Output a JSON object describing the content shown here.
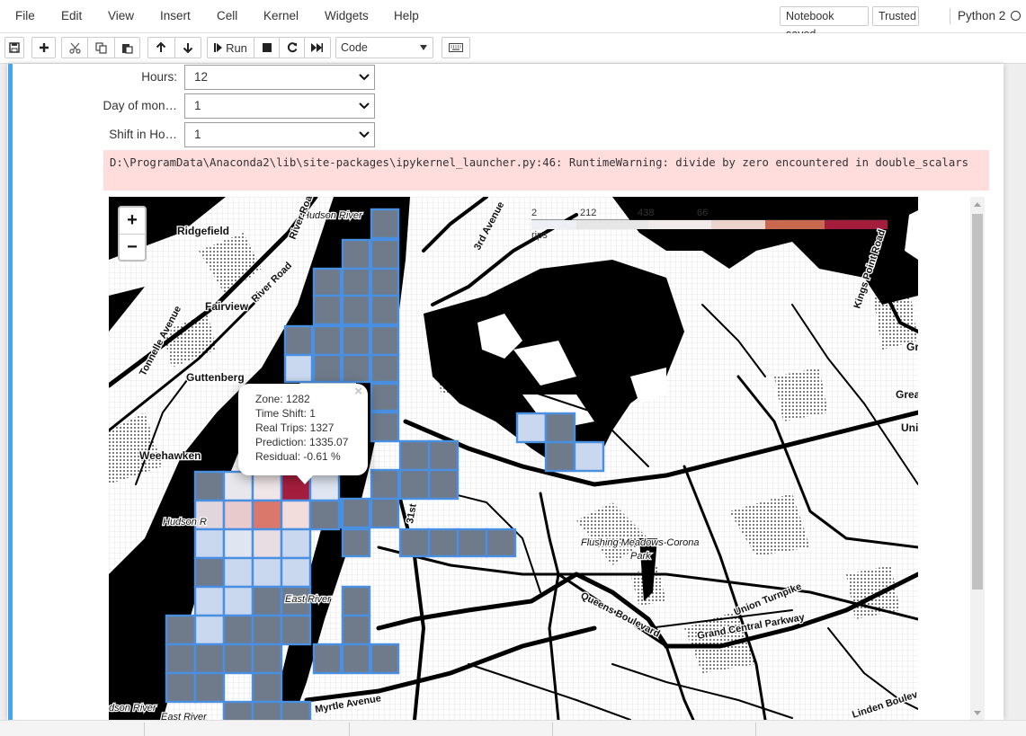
{
  "menubar": {
    "items": [
      "File",
      "Edit",
      "View",
      "Insert",
      "Cell",
      "Kernel",
      "Widgets",
      "Help"
    ],
    "notebook_saved": "Notebook saved",
    "trusted": "Trusted",
    "kernel": "Python 2"
  },
  "toolbar": {
    "run_label": "Run",
    "cell_type": "Code",
    "icons": [
      "save-icon",
      "plus-icon",
      "cut-icon",
      "copy-icon",
      "paste-icon",
      "arrow-up-icon",
      "arrow-down-icon",
      "step-forward-icon",
      "stop-icon",
      "restart-icon",
      "fast-forward-icon",
      "keyboard-icon"
    ]
  },
  "widgets": {
    "hours": {
      "label": "Hours:",
      "value": "12"
    },
    "day_of_month": {
      "label": "Day of mon…",
      "value": "1"
    },
    "shift_in_hours": {
      "label": "Shift in Ho…",
      "value": "1"
    }
  },
  "stderr": {
    "text": "D:\\ProgramData\\Anaconda2\\lib\\site-packages\\ipykernel_launcher.py:46: RuntimeWarning: divide by zero encountered in double_scalars"
  },
  "map": {
    "zoom_in": "+",
    "zoom_out": "−",
    "legend": {
      "ticks": [
        "2",
        "212",
        "438",
        "66"
      ],
      "caption": "rips"
    },
    "place_labels": {
      "ridgefield": "Ridgefield",
      "fairview": "Fairview",
      "guttenberg": "Guttenberg",
      "weehawken": "Weehawken",
      "hudson_river_top": "Hudson River",
      "hudson_river_mid": "Hudson R",
      "hudson_river_bottom": "dson River",
      "east_river_mid": "East River",
      "east_river_bottom": "East River",
      "river_road_1": "River Road",
      "river_road_2": "River Road",
      "tonnelle": "Tonnelle Avenue",
      "third_avenue": "3rd Avenue",
      "st31": "31st",
      "kings_point": "Kings Point Road",
      "flushing": "Flushing Meadows-Corona",
      "park": "Park",
      "queens_blvd": "Queens Boulevard",
      "union_tpke": "Union Turnpike",
      "grand_central": "Grand Central Parkway",
      "myrtle": "Myrtle Avenue",
      "linden": "Linden Boulev",
      "gr": "Gr",
      "grea": "Grea",
      "uni": "Uni"
    },
    "popup": {
      "zone": "Zone: 1282",
      "time_shift": "Time Shift: 1",
      "real_trips": "Real Trips: 1327",
      "prediction": "Prediction: 1335.07",
      "residual": "Residual: -0.61 %",
      "close": "×"
    }
  },
  "colors": {
    "cell_border": "#42a5f5",
    "stderr_bg": "#ffdddd",
    "zone_grey": "#6f7b8a",
    "zone_light": "#c9d8ee",
    "zone_red": "#a51d3c"
  }
}
